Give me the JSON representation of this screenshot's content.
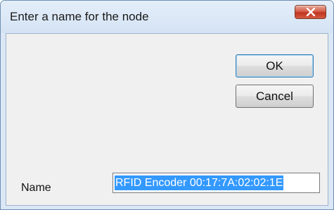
{
  "dialog": {
    "title": "Enter a name for the node"
  },
  "buttons": {
    "ok_label": "OK",
    "cancel_label": "Cancel"
  },
  "form": {
    "name_label": "Name",
    "name_value": "RFID Encoder 00:17:7A:02:02:1E"
  },
  "colors": {
    "close_button": "#c7432b",
    "selection_highlight": "#3399ff",
    "dialog_background": "#f0f0f0"
  },
  "icons": {
    "close": "close-icon"
  }
}
